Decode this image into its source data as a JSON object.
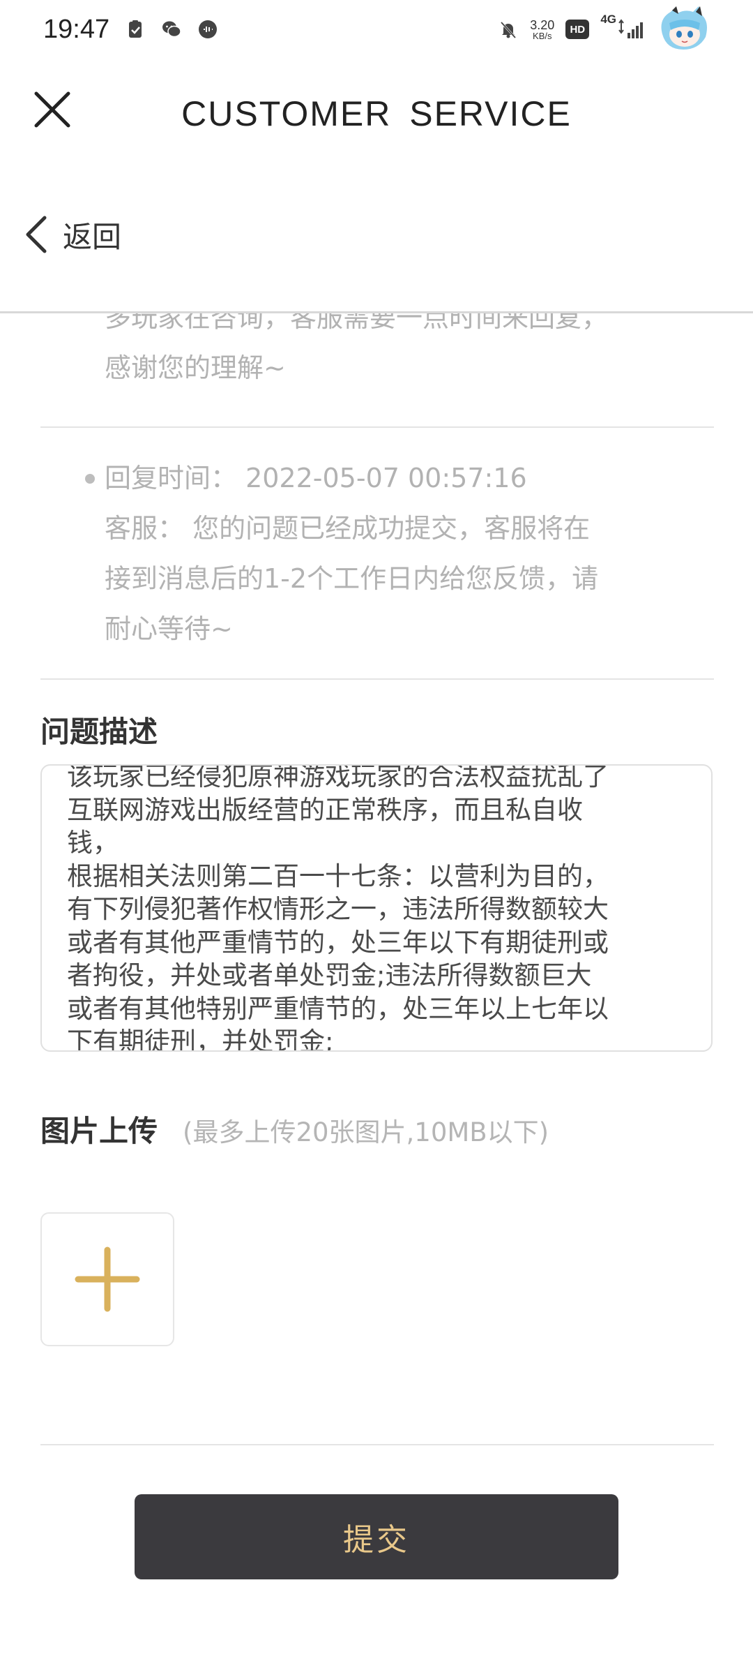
{
  "status_bar": {
    "time": "19:47",
    "net_speed_value": "3.20",
    "net_speed_unit": "KB/s",
    "hd_label": "HD",
    "network_label": "4G"
  },
  "header": {
    "title": "CUSTOMER  SERVICE",
    "back_label": "返回"
  },
  "conversation": {
    "cut_lines": [
      "多玩家在咨询，客服需要一点时间来回复，",
      "感谢您的理解~"
    ],
    "reply": {
      "lines": [
        "回复时间：  2022-05-07 00:57:16",
        "客服：  您的问题已经成功提交，客服将在",
        "接到消息后的1-2个工作日内给您反馈，请",
        "耐心等待~"
      ]
    }
  },
  "problem": {
    "title": "问题描述",
    "text": "该玩家已经侵犯原神游戏玩家的合法权益扰乱了\n互联网游戏出版经营的正常秩序，而且私自收\n钱，\n根据相关法则第二百一十七条：以营利为目的，\n有下列侵犯著作权情形之一，违法所得数额较大\n或者有其他严重情节的，处三年以下有期徒刑或\n者拘役，并处或者单处罚金;违法所得数额巨大\n或者有其他特别严重情节的，处三年以上七年以\n下有期徒刑，并处罚金;"
  },
  "upload": {
    "title": "图片上传",
    "hint": "(最多上传20张图片,10MB以下)"
  },
  "submit_label": "提交",
  "colors": {
    "accent": "#d9b15c",
    "submit_bg": "#3b3a3e",
    "submit_text": "#e9c88a"
  }
}
